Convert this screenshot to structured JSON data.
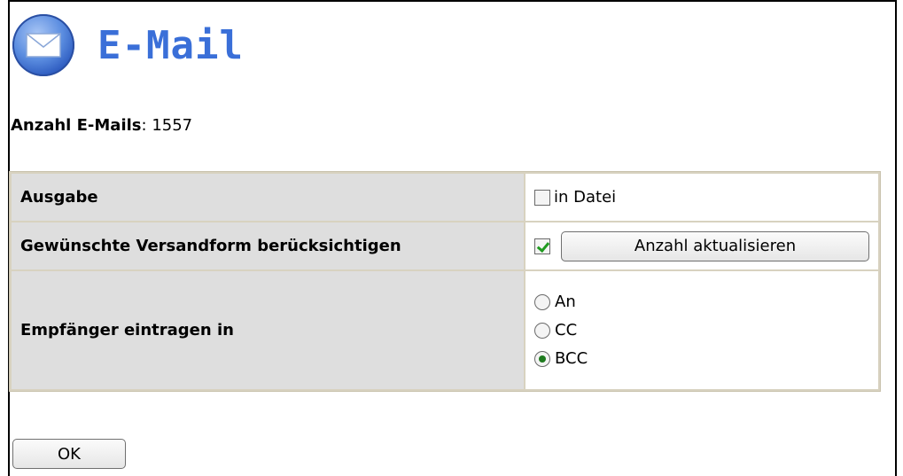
{
  "header": {
    "title": "E-Mail",
    "icon": "mail-icon"
  },
  "count": {
    "label": "Anzahl E-Mails",
    "separator": ":",
    "value": "1557"
  },
  "options": {
    "output": {
      "label": "Ausgabe",
      "checkbox_label": "in Datei",
      "checked": false
    },
    "dispatch": {
      "label": "Gewünschte Versandform berücksichtigen",
      "checked": true,
      "button_label": "Anzahl aktualisieren"
    },
    "recipients": {
      "label": "Empfänger eintragen in",
      "choices": [
        {
          "label": "An",
          "selected": false
        },
        {
          "label": "CC",
          "selected": false
        },
        {
          "label": "BCC",
          "selected": true
        }
      ]
    }
  },
  "ok_label": "OK"
}
